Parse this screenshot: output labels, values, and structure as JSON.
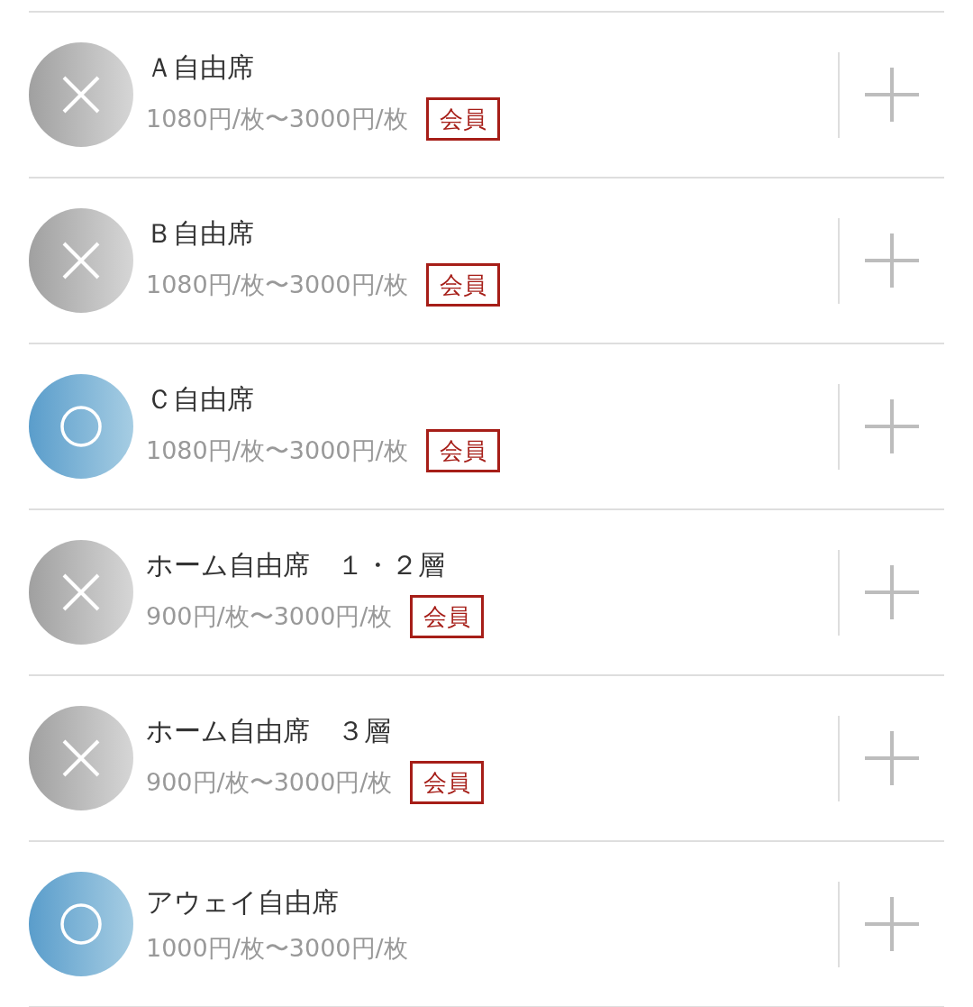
{
  "rows": [
    {
      "title": "Ａ自由席",
      "price": "1080円/枚〜3000円/枚",
      "badge": "会員",
      "available": false
    },
    {
      "title": "Ｂ自由席",
      "price": "1080円/枚〜3000円/枚",
      "badge": "会員",
      "available": false
    },
    {
      "title": "Ｃ自由席",
      "price": "1080円/枚〜3000円/枚",
      "badge": "会員",
      "available": true
    },
    {
      "title": "ホーム自由席　１・２層",
      "price": "900円/枚〜3000円/枚",
      "badge": "会員",
      "available": false
    },
    {
      "title": "ホーム自由席　３層",
      "price": "900円/枚〜3000円/枚",
      "badge": "会員",
      "available": false
    },
    {
      "title": "アウェイ自由席",
      "price": "1000円/枚〜3000円/枚",
      "available": true
    }
  ]
}
